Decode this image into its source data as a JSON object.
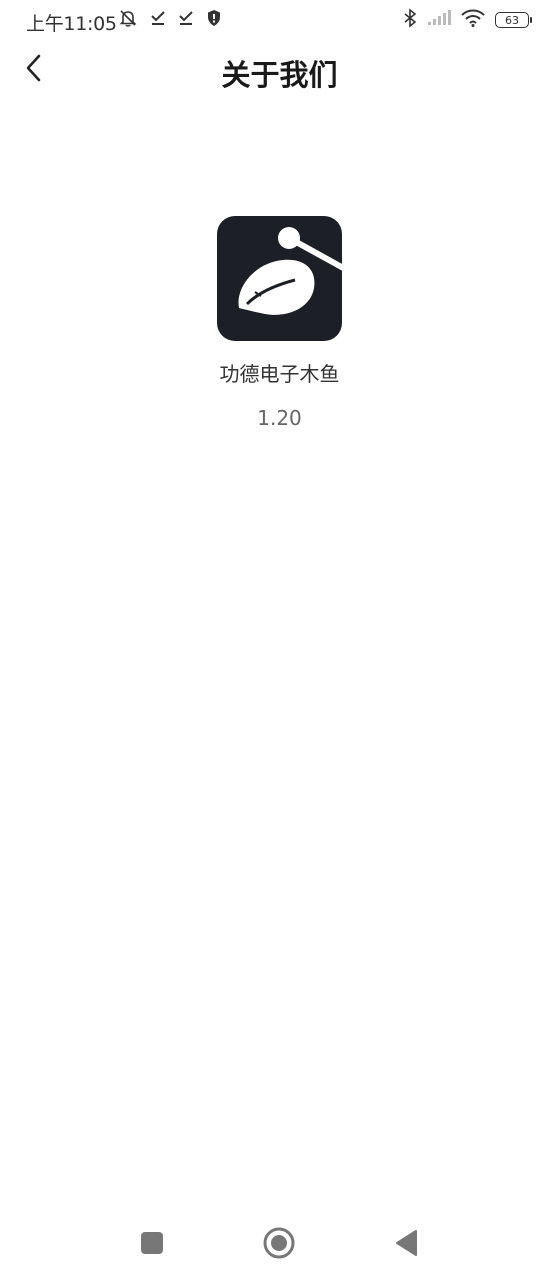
{
  "status_bar": {
    "time": "上午11:05",
    "battery_level": "63",
    "icons_left": [
      "mute-bell-icon",
      "check-icon",
      "check-icon",
      "shield-icon"
    ],
    "icons_right": [
      "bluetooth-icon",
      "signal-icon",
      "wifi-icon",
      "battery-icon"
    ]
  },
  "header": {
    "title": "关于我们",
    "back_icon": "chevron-left-icon"
  },
  "app": {
    "name": "功德电子木鱼",
    "version": "1.20",
    "logo_icon": "wooden-fish-icon",
    "logo_bg": "#1c1f26"
  },
  "nav_bar": {
    "buttons": [
      "recents-square-icon",
      "home-circle-icon",
      "back-triangle-icon"
    ]
  }
}
